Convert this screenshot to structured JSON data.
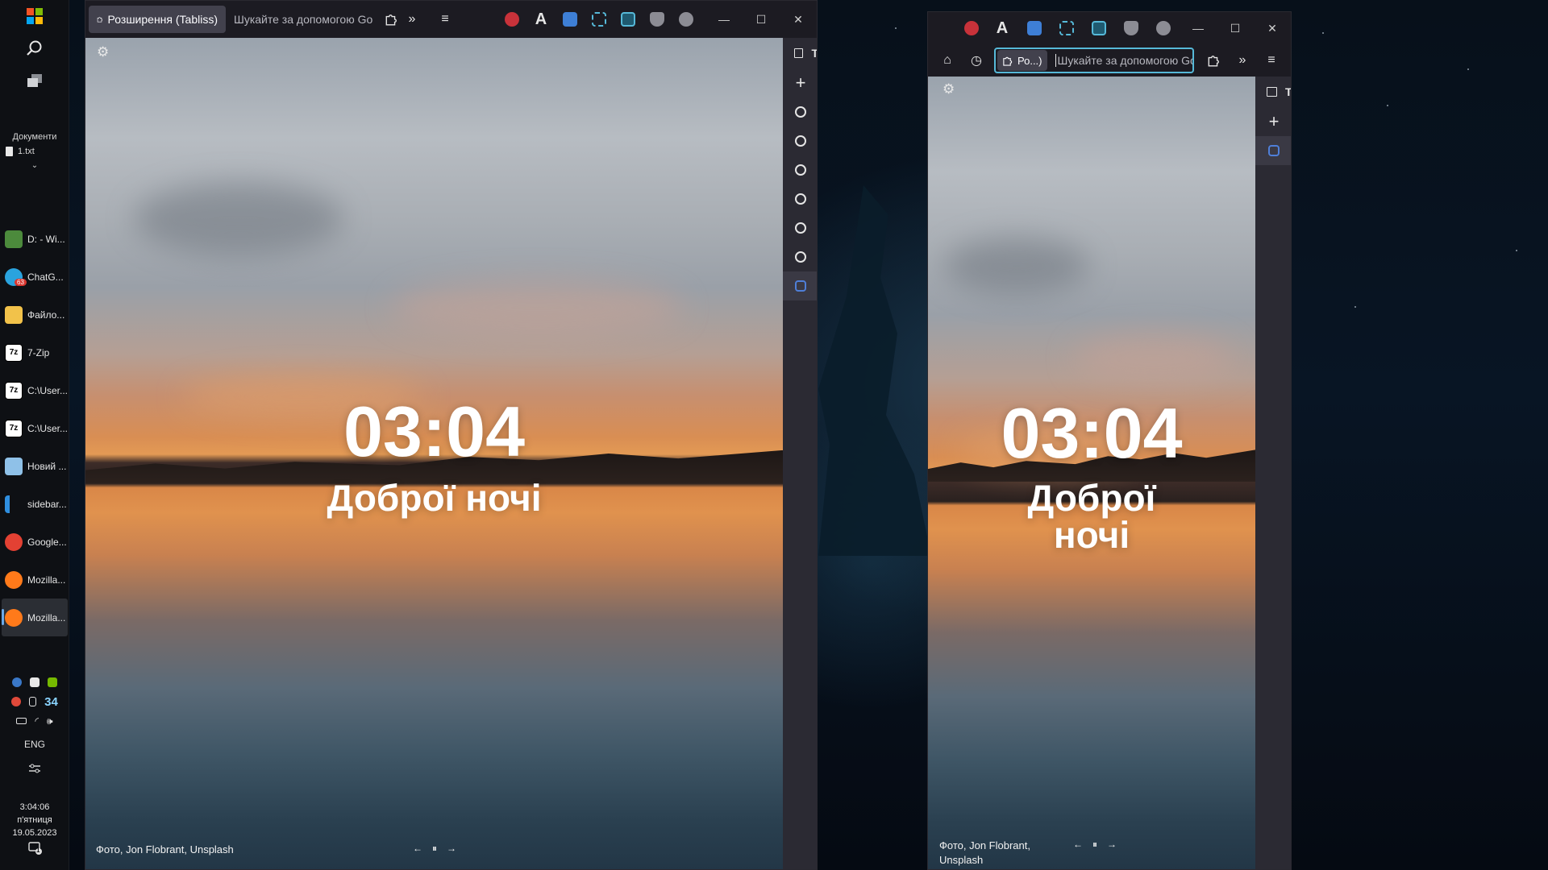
{
  "taskbar": {
    "documents_label": "Документи",
    "file_name": "1.txt",
    "apps": [
      {
        "label": "D: - Wi...",
        "icon": "tree-icon",
        "color": "#4c8a3c"
      },
      {
        "label": "ChatG...",
        "icon": "telegram-icon",
        "color": "#2aa3de",
        "badge": "63"
      },
      {
        "label": "Файло...",
        "icon": "folder-icon",
        "color": "#f2c24a"
      },
      {
        "label": "7-Zip",
        "icon": "7zip-icon",
        "color": "#ffffff"
      },
      {
        "label": "C:\\User...",
        "icon": "7zip-icon",
        "color": "#ffffff"
      },
      {
        "label": "C:\\User...",
        "icon": "7zip-icon",
        "color": "#ffffff"
      },
      {
        "label": "Новий ...",
        "icon": "notepad-icon",
        "color": "#8fc1e8"
      },
      {
        "label": "sidebar...",
        "icon": "vscode-icon",
        "color": "#2f8fe0"
      },
      {
        "label": "Google...",
        "icon": "chrome-icon",
        "color": "#e34133"
      },
      {
        "label": "Mozilla...",
        "icon": "firefox-icon",
        "color": "#ff7a1a"
      },
      {
        "label": "Mozilla...",
        "icon": "firefox-icon",
        "color": "#ff7a1a",
        "active": true
      }
    ],
    "temperature": "34",
    "language": "ENG",
    "time": "3:04:06",
    "weekday": "п'ятниця",
    "date": "19.05.2023",
    "notification_count": "1"
  },
  "window_left": {
    "tab_label": "Розширення (Tabliss)",
    "url_placeholder": "Шукайте за допомогою Go",
    "clock": "03:04",
    "greeting": "Доброї ночі",
    "credit": "Фото, Jon Flobrant, Unsplash",
    "sidebar_peek_letter": "T"
  },
  "window_right": {
    "tab_label": "Ро...)",
    "url_placeholder": "Шукайте за допомогою Go",
    "clock": "03:04",
    "greeting_line1": "Доброї",
    "greeting_line2": "ночі",
    "credit_line1": "Фото, Jon Flobrant,",
    "credit_line2": "Unsplash",
    "sidebar_peek_letter": "T"
  },
  "colors": {
    "accent": "#56b9d8",
    "browser_bg": "#1c1b22",
    "sidebar_bg": "#2b2a33",
    "tab_bg": "#42414d"
  }
}
